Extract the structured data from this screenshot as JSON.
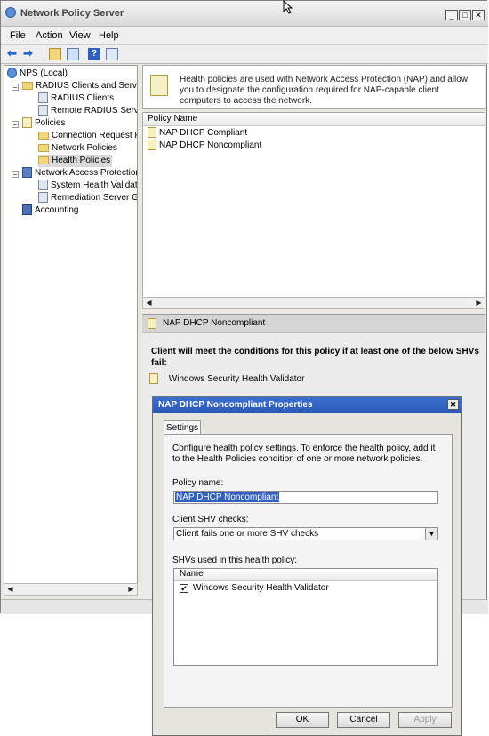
{
  "window": {
    "title": "Network Policy Server",
    "menu": [
      "File",
      "Action",
      "View",
      "Help"
    ]
  },
  "tree": {
    "root": "NPS (Local)",
    "radius_group": "RADIUS Clients and Server",
    "radius_clients": "RADIUS Clients",
    "remote_radius": "Remote RADIUS Server",
    "policies": "Policies",
    "connection_request": "Connection Request Po",
    "network_policies": "Network Policies",
    "health_policies": "Health Policies",
    "nap": "Network Access Protection",
    "shv": "System Health Validato",
    "remediation": "Remediation Server Gro",
    "accounting": "Accounting"
  },
  "description": "Health policies are used with Network Access Protection (NAP) and allow you to designate the configuration required for NAP-capable client computers to access the network.",
  "policy_list": {
    "column": "Policy Name",
    "rows": [
      "NAP DHCP Compliant",
      "NAP DHCP Noncompliant"
    ]
  },
  "details": {
    "header": "NAP DHCP Noncompliant",
    "condition": "Client will meet the conditions for this policy if at least one of the below SHVs fail:",
    "shv": "Windows Security Health Validator"
  },
  "dialog": {
    "title": "NAP DHCP Noncompliant Properties",
    "tab": "Settings",
    "intro": "Configure health policy settings. To enforce the health policy, add it to the Health Policies condition of one or more network policies.",
    "policy_name_label": "Policy name:",
    "policy_name_value": "NAP DHCP Noncompliant",
    "client_checks_label": "Client SHV checks:",
    "client_checks_value": "Client fails one or more SHV checks",
    "shvs_label": "SHVs used in this health policy:",
    "shv_column": "Name",
    "shv_item": "Windows Security Health Validator",
    "shv_item_checked": true,
    "ok": "OK",
    "cancel": "Cancel",
    "apply": "Apply"
  }
}
